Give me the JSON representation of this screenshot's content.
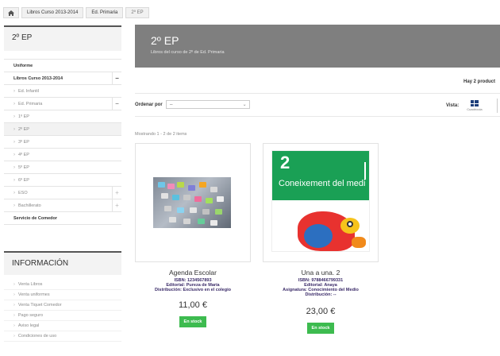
{
  "breadcrumb": {
    "home_icon": "home-icon",
    "items": [
      "Libros Curso 2013-2014",
      "Ed. Primaria",
      "2º EP"
    ]
  },
  "sidebar": {
    "title": "2º EP",
    "categories": [
      {
        "label": "Uniforme",
        "bold": true
      },
      {
        "label": "Libros Curso 2013-2014",
        "bold": true,
        "toggle": "−"
      },
      {
        "label": "Ed. Infantil",
        "toggle": ""
      },
      {
        "label": "Ed. Primaria",
        "toggle": "−"
      },
      {
        "label": "1º EP"
      },
      {
        "label": "2º EP",
        "active": true
      },
      {
        "label": "3º EP"
      },
      {
        "label": "4º EP"
      },
      {
        "label": "5º EP"
      },
      {
        "label": "6º EP"
      },
      {
        "label": "ESO",
        "toggle": "+"
      },
      {
        "label": "Bachillerato",
        "toggle": "+"
      },
      {
        "label": "Servicio de Comedor",
        "bold": true
      }
    ]
  },
  "info": {
    "title": "INFORMACIÓN",
    "items": [
      "Venta Libros",
      "Venta uniformes",
      "Venta Tiquet Comedor",
      "Pago seguro",
      "Aviso legal",
      "Condiciones de uso"
    ]
  },
  "banner": {
    "title": "2º EP",
    "subtitle": "Libros del curso de 2º de Ed. Primaria"
  },
  "listing": {
    "count_text": "Hay 2 product",
    "sort_label": "Ordenar por",
    "sort_value": "--",
    "view_label": "Vista:",
    "grid_label": "Cuadrícula",
    "showing_text": "Mostrando 1 - 2 de 2 items"
  },
  "products": [
    {
      "name": "Agenda Escolar",
      "isbn": "ISBN: 1234567893",
      "line2": "Editorial: Pureza de María",
      "line3": "Distribución: Exclusivo en el colegio",
      "price": "11,00 €",
      "stock": "En stock"
    },
    {
      "name": "Una a una. 2",
      "isbn": "ISBN: 9788466799331",
      "line2": "Editorial: Anaya",
      "line3": "Asignatura: Conocimiento del Medio",
      "line4": "Distribución: --",
      "price": "23,00 €",
      "stock": "En stock",
      "cover": {
        "number": "2",
        "title": "Coneixement del medi"
      }
    }
  ],
  "colors": {
    "banner": "#7f7f7f",
    "stock": "#3dbb4f",
    "meta": "#3a2a68",
    "grid_icon": "#1d3e7a"
  }
}
